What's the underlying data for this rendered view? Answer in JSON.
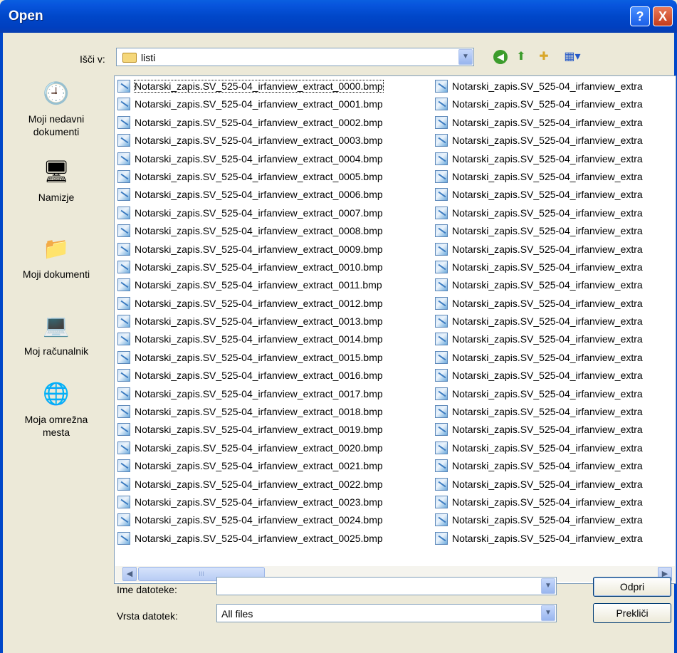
{
  "window": {
    "title": "Open",
    "help_label": "?",
    "close_label": "X"
  },
  "lookin": {
    "label": "Išči v:",
    "value": "listi"
  },
  "toolbar": {
    "back": "back-icon",
    "up": "up-folder-icon",
    "new_folder": "new-folder-icon",
    "views": "views-menu-icon"
  },
  "places": [
    {
      "label1": "Moji nedavni",
      "label2": "dokumenti"
    },
    {
      "label1": "Namizje",
      "label2": ""
    },
    {
      "label1": "Moji dokumenti",
      "label2": ""
    },
    {
      "label1": "Moj računalnik",
      "label2": ""
    },
    {
      "label1": "Moja omrežna",
      "label2": "mesta"
    }
  ],
  "files_col1": [
    "Notarski_zapis.SV_525-04_irfanview_extract_0000.bmp",
    "Notarski_zapis.SV_525-04_irfanview_extract_0001.bmp",
    "Notarski_zapis.SV_525-04_irfanview_extract_0002.bmp",
    "Notarski_zapis.SV_525-04_irfanview_extract_0003.bmp",
    "Notarski_zapis.SV_525-04_irfanview_extract_0004.bmp",
    "Notarski_zapis.SV_525-04_irfanview_extract_0005.bmp",
    "Notarski_zapis.SV_525-04_irfanview_extract_0006.bmp",
    "Notarski_zapis.SV_525-04_irfanview_extract_0007.bmp",
    "Notarski_zapis.SV_525-04_irfanview_extract_0008.bmp",
    "Notarski_zapis.SV_525-04_irfanview_extract_0009.bmp",
    "Notarski_zapis.SV_525-04_irfanview_extract_0010.bmp",
    "Notarski_zapis.SV_525-04_irfanview_extract_0011.bmp",
    "Notarski_zapis.SV_525-04_irfanview_extract_0012.bmp",
    "Notarski_zapis.SV_525-04_irfanview_extract_0013.bmp",
    "Notarski_zapis.SV_525-04_irfanview_extract_0014.bmp",
    "Notarski_zapis.SV_525-04_irfanview_extract_0015.bmp",
    "Notarski_zapis.SV_525-04_irfanview_extract_0016.bmp",
    "Notarski_zapis.SV_525-04_irfanview_extract_0017.bmp",
    "Notarski_zapis.SV_525-04_irfanview_extract_0018.bmp",
    "Notarski_zapis.SV_525-04_irfanview_extract_0019.bmp",
    "Notarski_zapis.SV_525-04_irfanview_extract_0020.bmp",
    "Notarski_zapis.SV_525-04_irfanview_extract_0021.bmp",
    "Notarski_zapis.SV_525-04_irfanview_extract_0022.bmp",
    "Notarski_zapis.SV_525-04_irfanview_extract_0023.bmp",
    "Notarski_zapis.SV_525-04_irfanview_extract_0024.bmp",
    "Notarski_zapis.SV_525-04_irfanview_extract_0025.bmp"
  ],
  "files_col2_visible": "Notarski_zapis.SV_525-04_irfanview_extra",
  "filename": {
    "label": "Ime datoteke:",
    "value": ""
  },
  "filetype": {
    "label": "Vrsta datotek:",
    "value": "All files"
  },
  "buttons": {
    "open": "Odpri",
    "cancel": "Prekliči"
  },
  "scroll": {
    "left": "◀",
    "right": "▶",
    "grip": "III"
  },
  "combo_arrow": "▼"
}
